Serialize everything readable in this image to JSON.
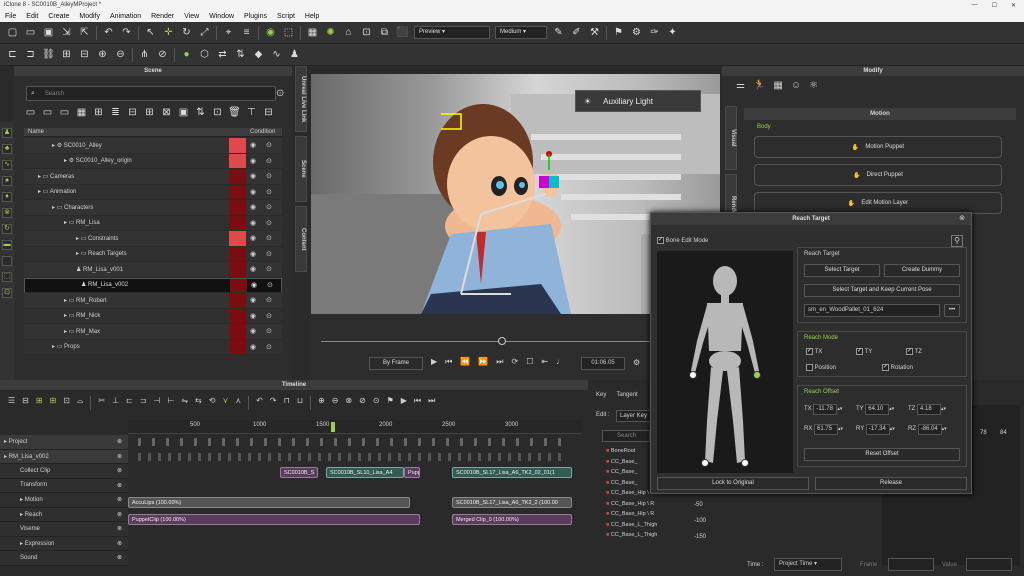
{
  "app": {
    "title": "iClone 8 - SC0010B_AlleyMProject *"
  },
  "menu": [
    "File",
    "Edit",
    "Create",
    "Modify",
    "Animation",
    "Render",
    "View",
    "Window",
    "Plugins",
    "Script",
    "Help"
  ],
  "toolbar": {
    "preview": "Preview",
    "quality": "Medium"
  },
  "scene": {
    "title": "Scene",
    "search_placeholder": "Search",
    "col_name": "Name",
    "col_condition": "Condition",
    "rows": [
      {
        "label": "SC0010_Alley",
        "indent": 28,
        "hi": true
      },
      {
        "label": "SC0010_Alley_origin",
        "indent": 40,
        "hi": true
      },
      {
        "label": "Cameras",
        "indent": 14,
        "hi": false
      },
      {
        "label": "Animation",
        "indent": 14,
        "hi": false
      },
      {
        "label": "Characters",
        "indent": 28,
        "hi": false
      },
      {
        "label": "RM_Lisa",
        "indent": 40,
        "hi": false
      },
      {
        "label": "Constraints",
        "indent": 52,
        "hi": true
      },
      {
        "label": "Reach Targets",
        "indent": 52,
        "hi": false
      },
      {
        "label": "RM_Lisa_v001",
        "indent": 52,
        "hi": false
      },
      {
        "label": "RM_Lisa_v002",
        "indent": 52,
        "hi": false
      },
      {
        "label": "RM_Robert",
        "indent": 40,
        "hi": false
      },
      {
        "label": "RM_Nick",
        "indent": 40,
        "hi": false
      },
      {
        "label": "RM_Max",
        "indent": 40,
        "hi": false
      },
      {
        "label": "Props",
        "indent": 28,
        "hi": false
      }
    ]
  },
  "side_tabs": [
    "Unreal Live Link",
    "Scene",
    "Content"
  ],
  "viewport": {
    "aux_light": "Auxiliary Light",
    "by_frame": "By Frame",
    "time": "01:06.05"
  },
  "modify": {
    "title": "Modify",
    "motion": "Motion",
    "body": "Body",
    "motion_puppet": "Motion Puppet",
    "direct_puppet": "Direct Puppet",
    "edit_motion_layer": "Edit Motion Layer",
    "tabs": [
      "Visual",
      "Render"
    ]
  },
  "reach": {
    "title": "Reach Target",
    "bone_edit": "Bone Edit Mode",
    "reach_target": "Reach Target",
    "select_target": "Select Target",
    "create_dummy": "Create  Dummy",
    "select_keep": "Select Target and Keep Current Pose",
    "target_value": "sm_en_WoodPallet_01_624",
    "reach_mode": "Reach Mode",
    "tx": "TX",
    "ty": "TY",
    "tz": "TZ",
    "position": "Position",
    "rotation": "Rotation",
    "reach_offset": "Reach Offset",
    "off": [
      {
        "l": "TX",
        "v": "-11.78"
      },
      {
        "l": "TY",
        "v": "64.10"
      },
      {
        "l": "TZ",
        "v": "4.18"
      },
      {
        "l": "RX",
        "v": "61.75"
      },
      {
        "l": "RY",
        "v": "-17.34"
      },
      {
        "l": "RZ",
        "v": "-86.04"
      }
    ],
    "reset_offset": "Reset Offset",
    "lock": "Lock to Original",
    "release": "Release"
  },
  "timeline": {
    "title": "Timeline",
    "ticks": [
      "500",
      "1000",
      "1500",
      "2000",
      "2500",
      "3000"
    ],
    "rows": [
      "Project",
      "RM_Lisa_v002",
      "Collect Clip",
      "Transform",
      "Motion",
      "Reach",
      "Viseme",
      "Expression",
      "Sound"
    ],
    "clips": {
      "m1": "SC0010B_S",
      "m2": "SC0010B_SL10_Lisa_A4",
      "m3": "Pupp",
      "m4": "SC0010B_SL17_Lisa_A6_TK2_02_01(1",
      "v1": "AccuLips (100.00%)",
      "v2": "SC0010B_SL17_Lisa_A6_TK2_2 (100.00",
      "e1": "PuppetClip (100.00%)",
      "e2": "Merged Clip_0 (100.00%)"
    }
  },
  "curve": {
    "tabs": [
      "Key",
      "Tangent"
    ],
    "edit": "Edit :",
    "layer": "Layer Key",
    "search": "Search",
    "items": [
      "BoneRoot",
      "CC_Base_",
      "CC_Base_",
      "CC_Base_",
      "CC_Base_Hip \\ R",
      "CC_Base_Hip \\ R",
      "CC_Base_Hip \\ R",
      "CC_Base_L_Thigh",
      "CC_Base_L_Thigh"
    ],
    "yvals": [
      "-50",
      "-100",
      "-150"
    ],
    "xvals": [
      "78",
      "84"
    ],
    "time_label": "Time :",
    "time_mode": "Project Time",
    "frame": "Frame",
    "value": "Value"
  }
}
